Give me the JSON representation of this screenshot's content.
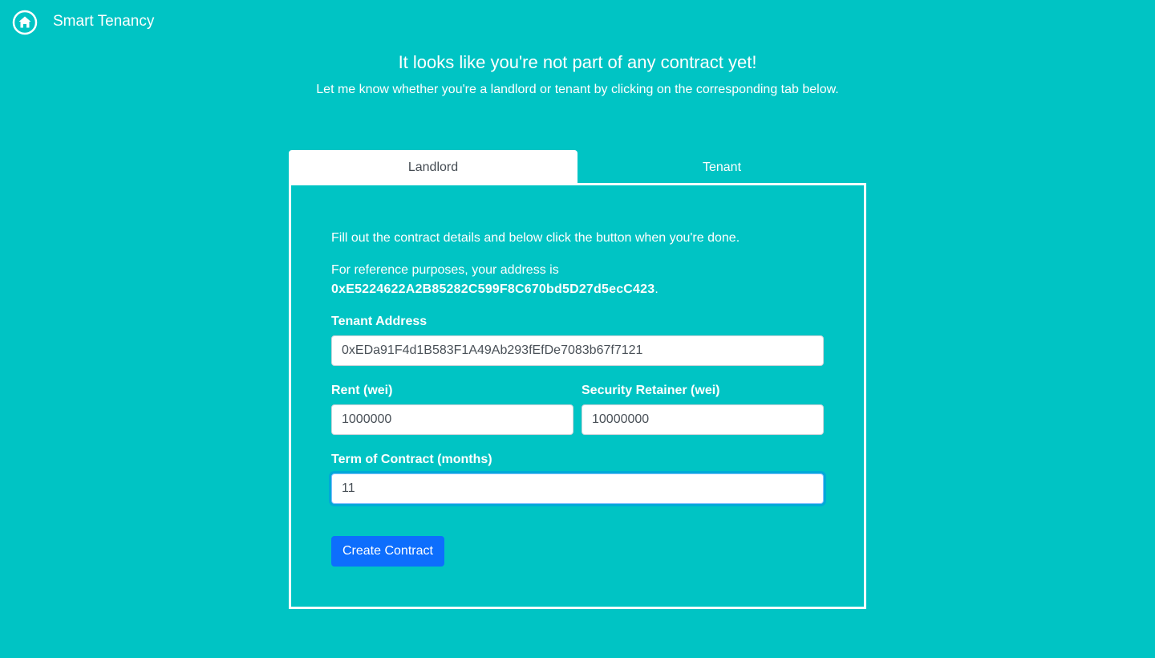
{
  "navbar": {
    "brand": "Smart Tenancy",
    "home_icon": "home-icon"
  },
  "intro": {
    "heading": "It looks like you're not part of any contract yet!",
    "subheading": "Let me know whether you're a landlord or tenant by clicking on the corresponding tab below."
  },
  "tabs": [
    {
      "label": "Landlord",
      "active": true
    },
    {
      "label": "Tenant",
      "active": false
    }
  ],
  "form": {
    "instructions": "Fill out the contract details and below click the button when you're done.",
    "reference_prefix": "For reference purposes, your address is",
    "own_address": "0xE5224622A2B85282C599F8C670bd5D27d5ecC423",
    "reference_suffix": ".",
    "fields": {
      "tenant_address": {
        "label": "Tenant Address",
        "value": "0xEDa91F4d1B583F1A49Ab293fEfDe7083b67f7121"
      },
      "rent": {
        "label": "Rent (wei)",
        "value": "1000000"
      },
      "security_retainer": {
        "label": "Security Retainer (wei)",
        "value": "10000000"
      },
      "term": {
        "label": "Term of Contract (months)",
        "value": "11"
      }
    },
    "submit_label": "Create Contract"
  },
  "colors": {
    "background": "#00c4c4",
    "primary_button": "#0d6efd",
    "tab_active_bg": "#ffffff",
    "tab_active_text": "#444b52"
  }
}
